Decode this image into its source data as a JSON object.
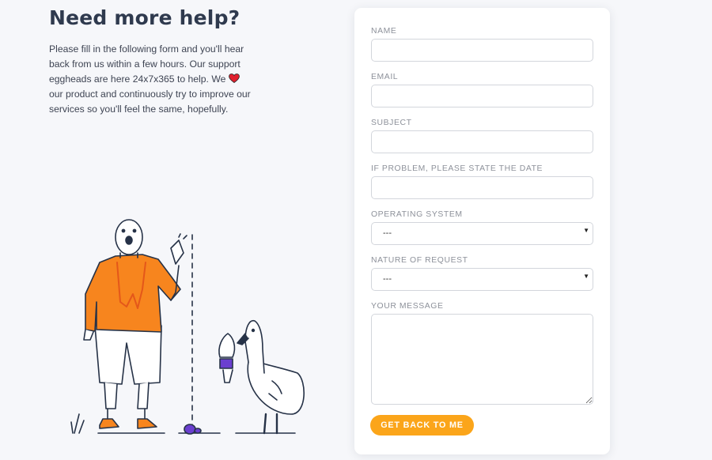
{
  "help": {
    "title": "Need more help?",
    "intro_before": "Please fill in the following form and you'll hear back from us within a few hours. Our support eggheads are here 24x7x365 to help. We ",
    "intro_after": " our product and continuously try to improve our services so you'll feel the same, hopefully.",
    "heart_icon": "heart-icon",
    "heart_color": "#e0202e"
  },
  "form": {
    "name_label": "NAME",
    "email_label": "EMAIL",
    "subject_label": "SUBJECT",
    "date_label": "IF PROBLEM, PLEASE STATE THE DATE",
    "os_label": "OPERATING SYSTEM",
    "os_value": "---",
    "request_label": "NATURE OF REQUEST",
    "request_value": "---",
    "message_label": "YOUR MESSAGE",
    "submit_label": "GET BACK TO ME",
    "accent": "#fba51a"
  }
}
